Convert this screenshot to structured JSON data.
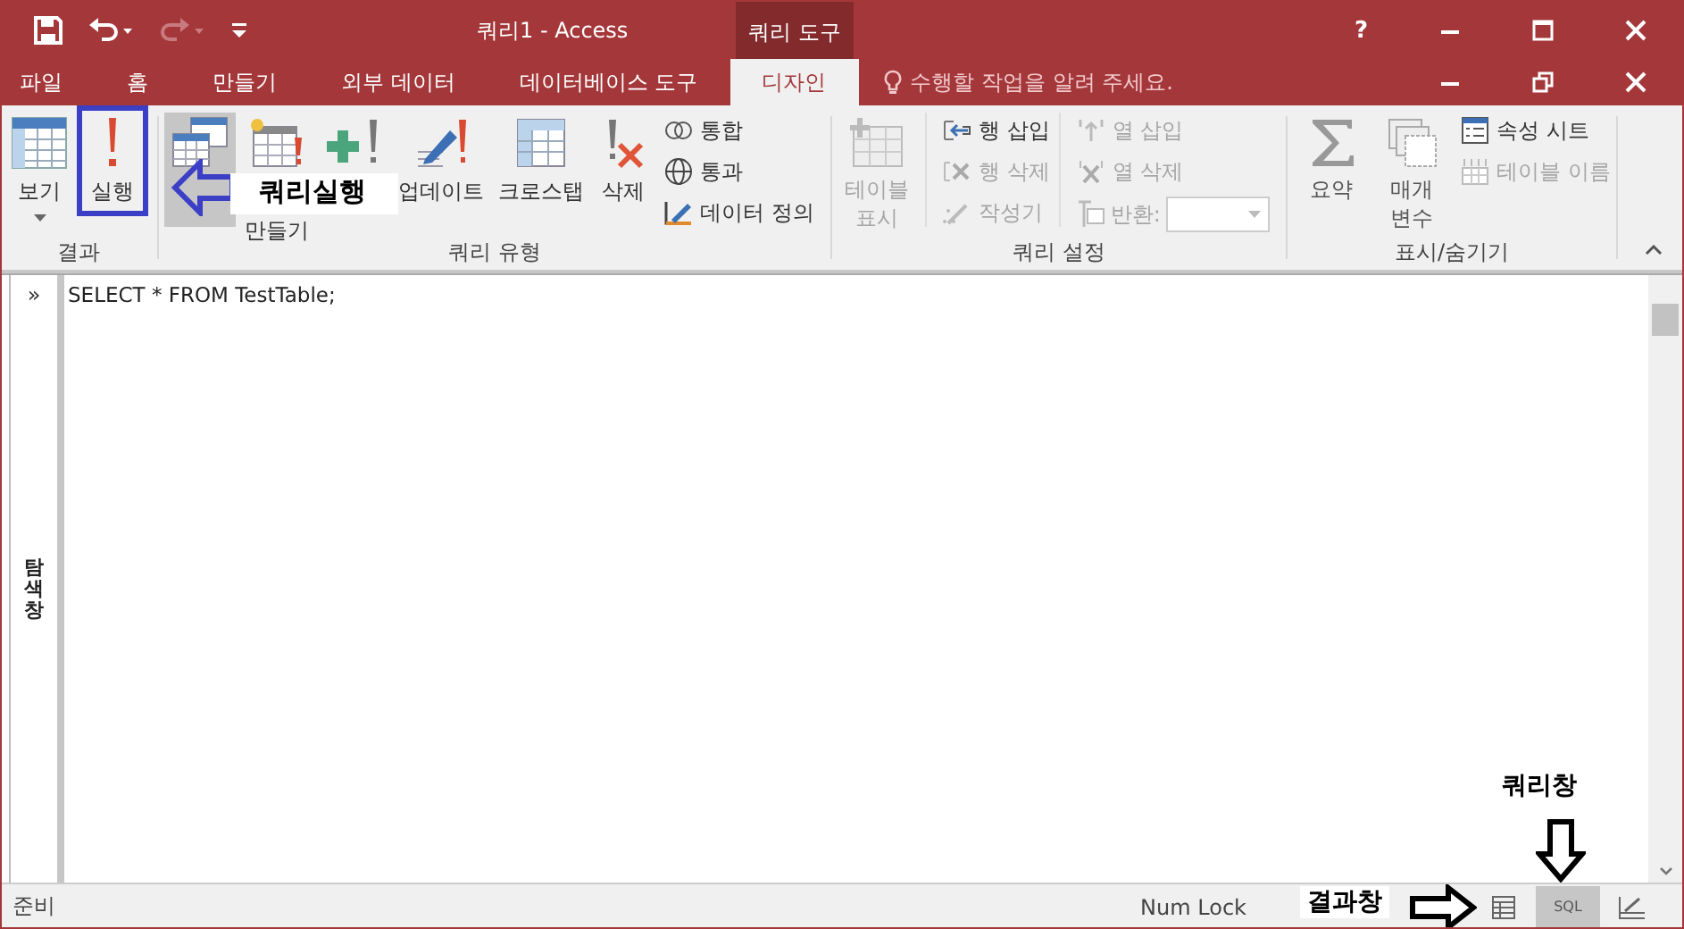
{
  "window": {
    "title": "쿼리1 - Access",
    "context_tab": "쿼리 도구",
    "help": "?"
  },
  "tabs": [
    {
      "label": "파일",
      "selected": false
    },
    {
      "label": "홈",
      "selected": false
    },
    {
      "label": "만들기",
      "selected": false
    },
    {
      "label": "외부 데이터",
      "selected": false
    },
    {
      "label": "데이터베이스 도구",
      "selected": false
    },
    {
      "label": "디자인",
      "selected": true
    }
  ],
  "tell_me": {
    "placeholder": "수행할 작업을 알려 주세요."
  },
  "ribbon": {
    "groups": [
      {
        "label": "결과",
        "buttons": [
          {
            "label": "보기"
          },
          {
            "label": "실행"
          }
        ]
      },
      {
        "label": "쿼리 유형",
        "buttons": [
          {
            "selected": true
          },
          {
            "label": "만들기",
            "selected": false
          },
          {
            "label": "업데이트",
            "selected": false
          },
          {
            "label": "크로스탭",
            "selected": false
          },
          {
            "label": "삭제",
            "selected": false
          }
        ],
        "small_buttons": [
          {
            "label": "통합"
          },
          {
            "label": "통과"
          },
          {
            "label": "데이터 정의"
          }
        ]
      },
      {
        "label": "쿼리 설정",
        "buttons": [
          {
            "label": "테이블 표시",
            "disabled": true
          }
        ],
        "small_buttons": [
          {
            "label": "행 삽입",
            "disabled": false
          },
          {
            "label": "행 삭제",
            "disabled": true
          },
          {
            "label": "작성기",
            "disabled": true
          },
          {
            "label": "열 삽입",
            "disabled": true
          },
          {
            "label": "열 삭제",
            "disabled": true
          }
        ],
        "return_field": {
          "label": "반환:",
          "disabled": true
        }
      },
      {
        "label": "표시/숨기기",
        "buttons": [
          {
            "label": "요약",
            "disabled": false
          },
          {
            "label": "매개 변수",
            "disabled": false
          }
        ],
        "small_buttons": [
          {
            "label": "속성 시트",
            "disabled": false
          },
          {
            "label": "테이블 이름",
            "disabled": true
          }
        ]
      }
    ]
  },
  "navigation_pane": {
    "toggle": "»",
    "label": "탐색 창"
  },
  "sql_editor": {
    "value": "SELECT * FROM TestTable;"
  },
  "status_bar": {
    "status": "준비",
    "num_lock": "Num Lock",
    "views": [
      {
        "kind": "datasheet",
        "selected": false
      },
      {
        "kind": "sql",
        "label": "SQL",
        "selected": true
      },
      {
        "kind": "design",
        "selected": false
      }
    ]
  },
  "annotations": [
    {
      "kind": "run",
      "label": "쿼리실행"
    },
    {
      "kind": "query",
      "label": "쿼리창"
    },
    {
      "kind": "result",
      "label": "결과창"
    }
  ]
}
